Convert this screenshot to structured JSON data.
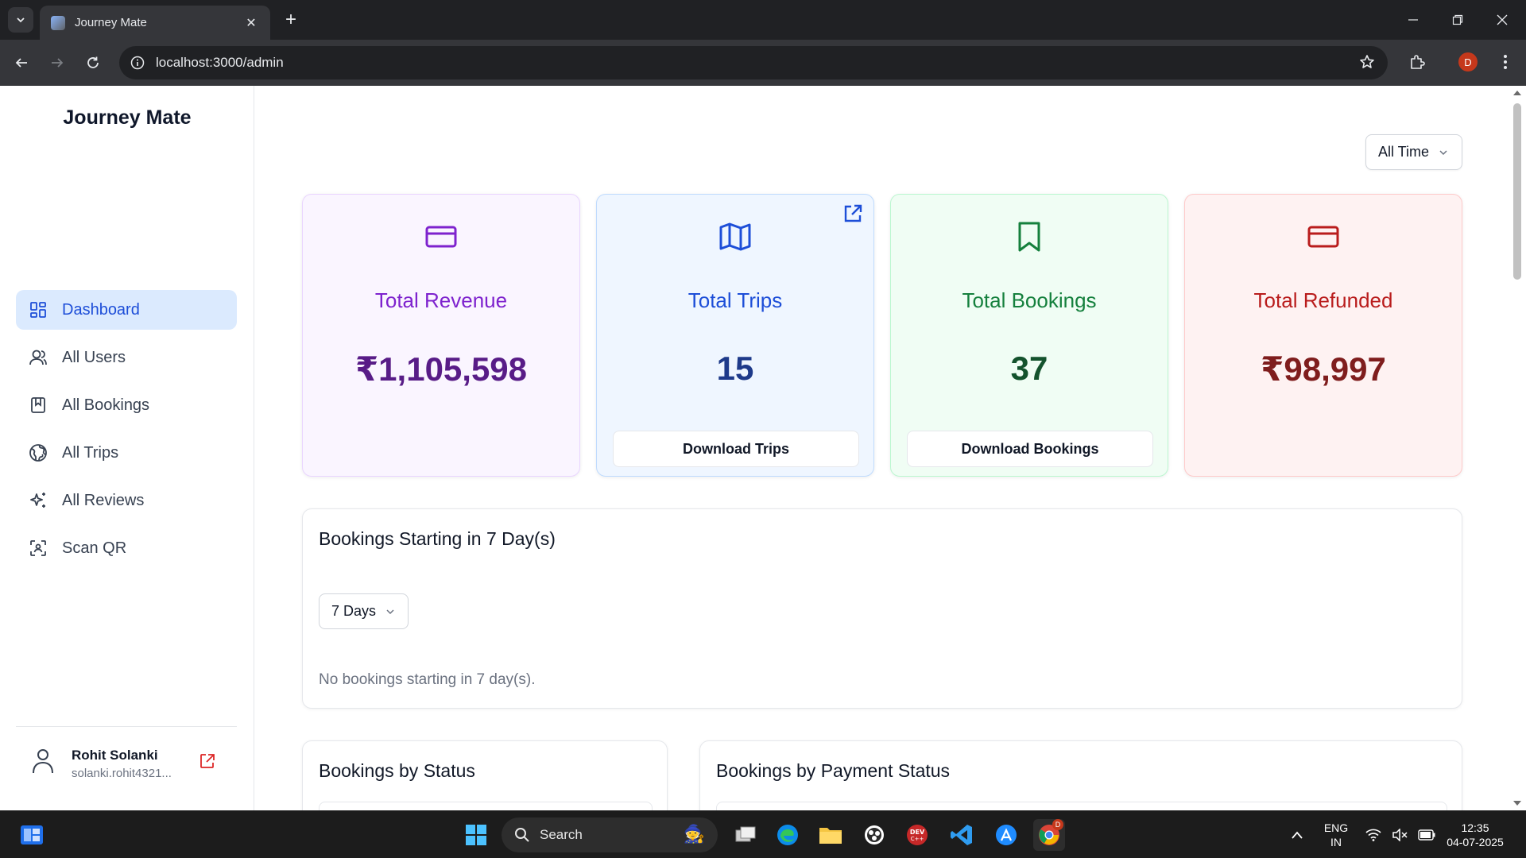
{
  "browser": {
    "tab_title": "Journey Mate",
    "url": "localhost:3000/admin",
    "profile_initial": "D"
  },
  "sidebar": {
    "brand": "Journey Mate",
    "items": [
      {
        "label": "Dashboard",
        "icon": "dashboard-icon",
        "active": true
      },
      {
        "label": "All Users",
        "icon": "user-icon"
      },
      {
        "label": "All Bookings",
        "icon": "bookmark-icon"
      },
      {
        "label": "All Trips",
        "icon": "globe-icon"
      },
      {
        "label": "All Reviews",
        "icon": "sparkles-icon"
      },
      {
        "label": "Scan QR",
        "icon": "scan-icon"
      }
    ],
    "user": {
      "name": "Rohit Solanki",
      "email": "solanki.rohit4321..."
    }
  },
  "main": {
    "range_filter": "All Time",
    "cards": [
      {
        "title": "Total Revenue",
        "value": "₹1,105,598",
        "icon": "credit-card-icon",
        "color": "#7e22ce",
        "value_color": "#581c87",
        "bg": "#faf5ff",
        "border": "#e9d5ff"
      },
      {
        "title": "Total Trips",
        "value": "15",
        "icon": "map-icon",
        "color": "#1d4ed8",
        "value_color": "#1e3a8a",
        "bg": "#eff6ff",
        "border": "#bfdbfe",
        "button": "Download Trips"
      },
      {
        "title": "Total Bookings",
        "value": "37",
        "icon": "bookmark-icon",
        "color": "#15803d",
        "value_color": "#14532d",
        "bg": "#f0fdf4",
        "border": "#bbf7d0",
        "button": "Download Bookings"
      },
      {
        "title": "Total Refunded",
        "value": "₹98,997",
        "icon": "credit-card-icon",
        "color": "#b91c1c",
        "value_color": "#7f1d1d",
        "bg": "#fef2f2",
        "border": "#fecaca"
      }
    ],
    "upcoming": {
      "title": "Bookings Starting in 7 Day(s)",
      "days_filter": "7 Days",
      "empty_message": "No bookings starting in 7 day(s)."
    },
    "status_panel": {
      "title": "Bookings by Status"
    },
    "payment_panel": {
      "title": "Bookings by Payment Status"
    }
  },
  "taskbar": {
    "search_placeholder": "Search",
    "lang_line1": "ENG",
    "lang_line2": "IN",
    "time": "12:35",
    "date": "04-07-2025"
  }
}
